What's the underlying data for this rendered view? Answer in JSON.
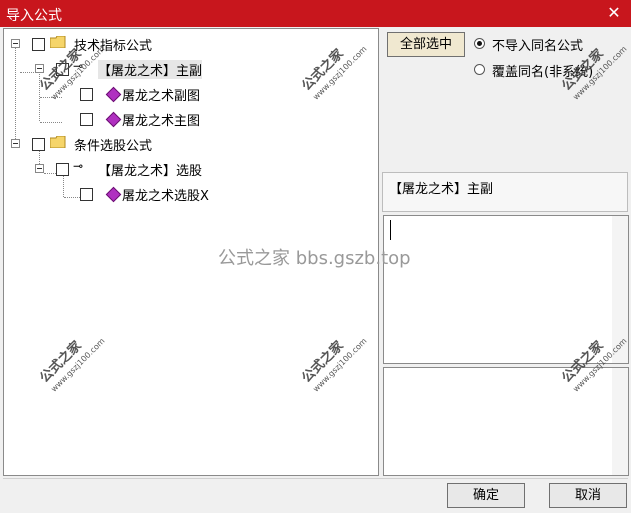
{
  "window": {
    "title": "导入公式",
    "close_glyph": "✕"
  },
  "tree": {
    "nodes": [
      {
        "label": "技术指标公式",
        "type": "folder"
      },
      {
        "label": "【屠龙之术】主副",
        "type": "group"
      },
      {
        "label": "屠龙之术副图",
        "type": "formula"
      },
      {
        "label": "屠龙之术主图",
        "type": "formula"
      },
      {
        "label": "条件选股公式",
        "type": "folder"
      },
      {
        "label": "【屠龙之术】选股",
        "type": "group"
      },
      {
        "label": "屠龙之术选股X",
        "type": "formula"
      }
    ]
  },
  "options": {
    "select_all_label": "全部选中",
    "radio_skip_label": "不导入同名公式",
    "radio_overwrite_label": "覆盖同名(非系统)",
    "selected_option": "radio_skip"
  },
  "formula_name": "【屠龙之术】主副",
  "buttons": {
    "ok_label": "确定",
    "cancel_label": "取消"
  },
  "watermark": {
    "title": "公式之家",
    "url": "www.gszj100.com",
    "center_text": "公式之家 bbs.gszb.top"
  },
  "colors": {
    "titlebar": "#c8161d",
    "formula_diamond": "#b030c0"
  }
}
